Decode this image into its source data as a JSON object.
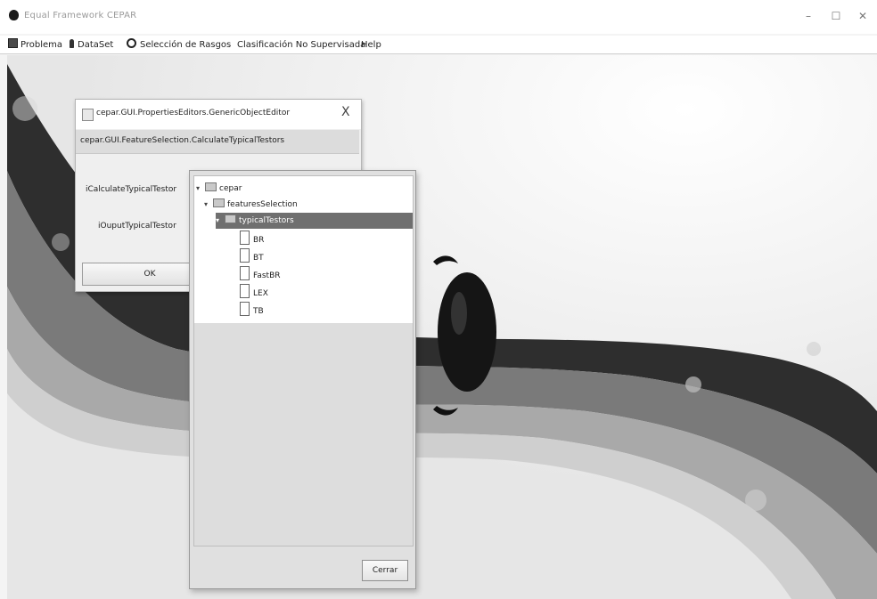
{
  "window": {
    "title": "Equal Framework CEPAR",
    "minimize": "–",
    "maximize": "☐",
    "close": "✕"
  },
  "menu": {
    "items": [
      {
        "label": "Problema",
        "icon": "problem-icon"
      },
      {
        "label": "DataSet",
        "icon": "dataset-icon"
      },
      {
        "label": "Selección de Rasgos",
        "icon": "gear-icon"
      },
      {
        "label": "Clasificación No Supervisada",
        "icon": ""
      },
      {
        "label": "Help",
        "icon": ""
      }
    ]
  },
  "editor_dialog": {
    "title": "cepar.GUI.PropertiesEditors.GenericObjectEditor",
    "close": "X",
    "class_name": "cepar.GUI.FeatureSelection.CalculateTypicalTestors",
    "properties": [
      "iCalculateTypicalTestor",
      "iOuputTypicalTestor"
    ],
    "ok_label": "OK"
  },
  "tree_popup": {
    "nodes": [
      {
        "label": "cepar",
        "type": "folder",
        "expanded": true,
        "selected": false
      },
      {
        "label": "featuresSelection",
        "type": "folder",
        "expanded": true,
        "selected": false
      },
      {
        "label": "typicalTestors",
        "type": "folder",
        "expanded": true,
        "selected": true
      },
      {
        "label": "BR",
        "type": "file",
        "expanded": false,
        "selected": false
      },
      {
        "label": "BT",
        "type": "file",
        "expanded": false,
        "selected": false
      },
      {
        "label": "FastBR",
        "type": "file",
        "expanded": false,
        "selected": false
      },
      {
        "label": "LEX",
        "type": "file",
        "expanded": false,
        "selected": false
      },
      {
        "label": "TB",
        "type": "file",
        "expanded": false,
        "selected": false
      }
    ],
    "close_label": "Cerrar",
    "expanded_glyph": "▾"
  },
  "colors": {
    "selection": "#6f6f6f",
    "ribbon_dark": "#2e2e2e",
    "ribbon_mid": "#7a7a7a"
  }
}
